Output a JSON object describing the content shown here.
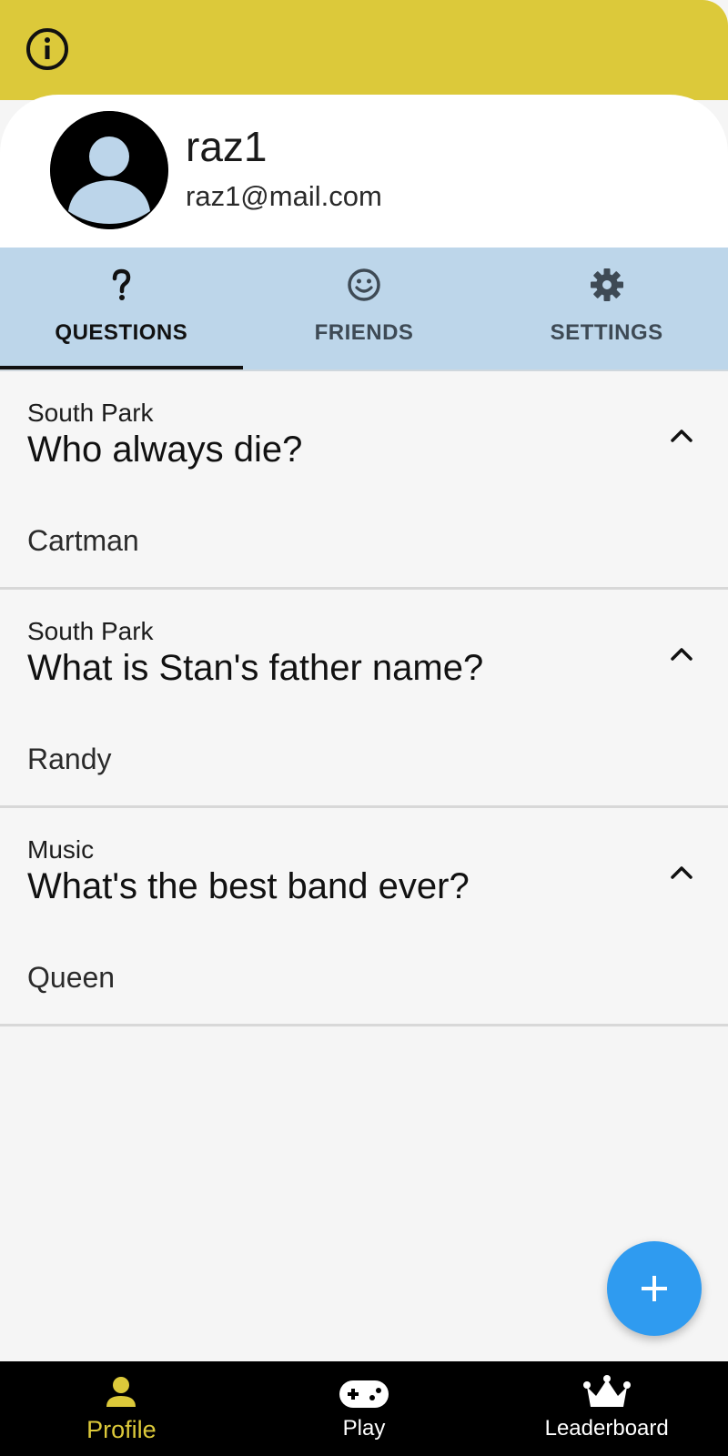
{
  "profile": {
    "username": "raz1",
    "email": "raz1@mail.com"
  },
  "tabs": [
    {
      "label": "QUESTIONS",
      "icon": "question-mark-icon",
      "active": true
    },
    {
      "label": "FRIENDS",
      "icon": "smiley-icon",
      "active": false
    },
    {
      "label": "SETTINGS",
      "icon": "gear-icon",
      "active": false
    }
  ],
  "questions": [
    {
      "category": "South Park",
      "question": "Who always die?",
      "answer": "Cartman"
    },
    {
      "category": "South Park",
      "question": "What is Stan's father name?",
      "answer": "Randy"
    },
    {
      "category": "Music",
      "question": "What's the best band ever?",
      "answer": "Queen"
    }
  ],
  "fab": {
    "icon": "plus-icon"
  },
  "bottom_nav": [
    {
      "label": "Profile",
      "icon": "person-icon",
      "active": true
    },
    {
      "label": "Play",
      "icon": "gamepad-icon",
      "active": false
    },
    {
      "label": "Leaderboard",
      "icon": "crown-icon",
      "active": false
    }
  ],
  "colors": {
    "accent_yellow": "#dcc93a",
    "tab_bg": "#bdd6ea",
    "fab_blue": "#2f9bf0",
    "nav_bg": "#000000"
  }
}
